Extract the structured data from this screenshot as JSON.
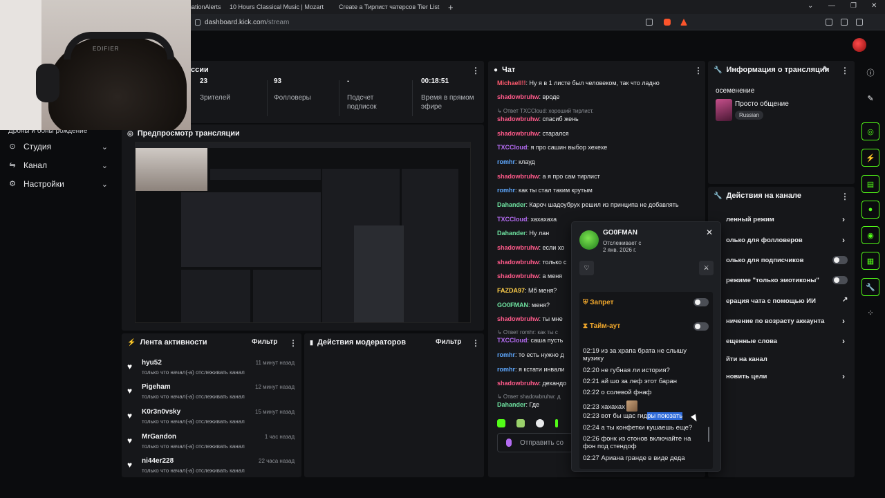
{
  "browser": {
    "tabs": [
      {
        "label": "nationAlerts"
      },
      {
        "label": "10 Hours Classical Music | Mozart"
      },
      {
        "label": "Create a Тирлист чатерсов Tier List -"
      }
    ],
    "address": {
      "host": "dashboard.kick.com",
      "path": "/stream"
    }
  },
  "stats": {
    "section_title": "ссии",
    "items": [
      {
        "value": "23",
        "label": "Зрителей"
      },
      {
        "value": "93",
        "label": "Фолловеры"
      },
      {
        "value": "-",
        "label": "Подсчет подписок"
      },
      {
        "value": "00:18:51",
        "label": "Время в прямом эфире"
      }
    ]
  },
  "nav": {
    "partial_label": "Дроны и боны рождение",
    "items": [
      {
        "label": "Студия"
      },
      {
        "label": "Канал"
      },
      {
        "label": "Настройки"
      }
    ]
  },
  "preview": {
    "title": "Предпросмотр трансляции"
  },
  "activity": {
    "title": "Лента активности",
    "filter": "Фильтр",
    "items": [
      {
        "name": "hyu52",
        "desc": "только что начал(-а) отслеживать канал",
        "time": "11 минут назад"
      },
      {
        "name": "Pigeham",
        "desc": "только что начал(-а) отслеживать канал",
        "time": "12 минут назад"
      },
      {
        "name": "K0r3n0vsky",
        "desc": "только что начал(-а) отслеживать канал",
        "time": "15 минут назад"
      },
      {
        "name": "MrGandon",
        "desc": "только что начал(-а) отслеживать канал",
        "time": "1 час назад"
      },
      {
        "name": "ni44er228",
        "desc": "только что начал(-а) отслеживать канал",
        "time": "22 часа назад"
      }
    ]
  },
  "mod_actions": {
    "title": "Действия модераторов",
    "filter": "Фильтр"
  },
  "chat": {
    "title": "Чат",
    "input_placeholder": "Отправить со",
    "messages": [
      {
        "user": "Michaell!!",
        "color": "#ff5a6e",
        "text": ": Ну я в 1 листе был человеком, так что ладно"
      },
      {
        "user": "shadowbruhw",
        "color": "#ff5a8a",
        "text": ": вроде"
      },
      {
        "reply": "↳ Ответ TXCCloud: хороший тирлист."
      },
      {
        "user": "shadowbruhw",
        "color": "#ff5a8a",
        "text": ": спасиб жень"
      },
      {
        "user": "shadowbruhw",
        "color": "#ff5a8a",
        "text": ": старался"
      },
      {
        "user": "TXCCloud",
        "color": "#b46cf2",
        "text": ": я про сашин выбор хехехе"
      },
      {
        "user": "romhr",
        "color": "#5ea8ff",
        "text": ": клауд"
      },
      {
        "user": "shadowbruhw",
        "color": "#ff5a8a",
        "text": ": а я про сам тирлист"
      },
      {
        "user": "romhr",
        "color": "#5ea8ff",
        "text": ": как ты стал таким крутым"
      },
      {
        "user": "Dahander",
        "color": "#6fe3a1",
        "text": ": Кароч шадоубрух решил из принципа не добавлять"
      },
      {
        "user": "TXCCloud",
        "color": "#b46cf2",
        "text": ": хахахаха"
      },
      {
        "user": "Dahander",
        "color": "#6fe3a1",
        "text": ": Ну лан"
      },
      {
        "user": "shadowbruhw",
        "color": "#ff5a8a",
        "text": ": если хо"
      },
      {
        "user": "shadowbruhw",
        "color": "#ff5a8a",
        "text": ": только с"
      },
      {
        "user": "shadowbruhw",
        "color": "#ff5a8a",
        "text": ": а меня"
      },
      {
        "user": "FAZDA97",
        "color": "#ffcf4a",
        "text": ": Мб меня?"
      },
      {
        "user": "GO0FMAN",
        "color": "#6fe3a1",
        "text": ": меня?"
      },
      {
        "user": "shadowbruhw",
        "color": "#ff5a8a",
        "text": ": ты мне"
      },
      {
        "reply": "↳ Ответ romhr: как ты с"
      },
      {
        "user": "TXCCloud",
        "color": "#b46cf2",
        "text": ": саша пусть"
      },
      {
        "user": "romhr",
        "color": "#5ea8ff",
        "text": ": то есть нужно д"
      },
      {
        "user": "romhr",
        "color": "#5ea8ff",
        "text": ": я кстати инвали"
      },
      {
        "user": "shadowbruhw",
        "color": "#ff5a8a",
        "text": ": дехандо"
      },
      {
        "reply": "↳ Ответ shadowbruhw: д"
      },
      {
        "user": "Dahander",
        "color": "#6fe3a1",
        "text": ": Где"
      }
    ]
  },
  "stream_info": {
    "title": "Информация о трансляции",
    "stream_title": "осеменение",
    "category": "Просто общение",
    "language": "Russian"
  },
  "channel_actions": {
    "title": "Действия на канале",
    "items": [
      {
        "label": "ленный режим",
        "control": "chevron"
      },
      {
        "label": "олько для фолловеров",
        "control": "chevron"
      },
      {
        "label": "олько для подписчиков",
        "control": "toggle"
      },
      {
        "label": "режиме \"только эмотиконы\"",
        "control": "toggle"
      },
      {
        "label": "ерация чата с помощью ИИ",
        "control": "external"
      },
      {
        "label": "ничение по возрасту аккаунта",
        "control": "chevron"
      },
      {
        "label": "ещенные слова",
        "control": "chevron"
      },
      {
        "label": "йти на канал",
        "control": "none"
      },
      {
        "label": "новить цели",
        "control": "chevron"
      }
    ]
  },
  "user_popup": {
    "username": "GO0FMAN",
    "following_label": "Отслеживает с",
    "following_date": "2 янв. 2026 г.",
    "ban_label": "Запрет",
    "timeout_label": "Тайм-аут",
    "messages": [
      {
        "time": "02:19",
        "text": "из за храпа брата не слышу музику"
      },
      {
        "time": "02:20",
        "text": "не губная ли история?"
      },
      {
        "time": "02:21",
        "text": "ай шо за леф этот баран"
      },
      {
        "time": "02:22",
        "text": "о солевой фнаф"
      },
      {
        "time": "02:23",
        "text": "хахахах"
      },
      {
        "time": "02:23",
        "text_before": "вот бы щас гид",
        "text_hl": "ры поюзать"
      },
      {
        "time": "02:24",
        "text": "а ты конфетки кушаешь еще?"
      },
      {
        "time": "02:26",
        "text": "фонк из стонов включайте на фон под стендоф"
      },
      {
        "time": "02:27",
        "text": "Ариана гранде в виде деда"
      }
    ]
  },
  "webcam": {
    "brand": "EDIFIER"
  },
  "colors": {
    "accent": "#53fc18",
    "panel": "#16171a",
    "background": "#0b0c0e"
  }
}
